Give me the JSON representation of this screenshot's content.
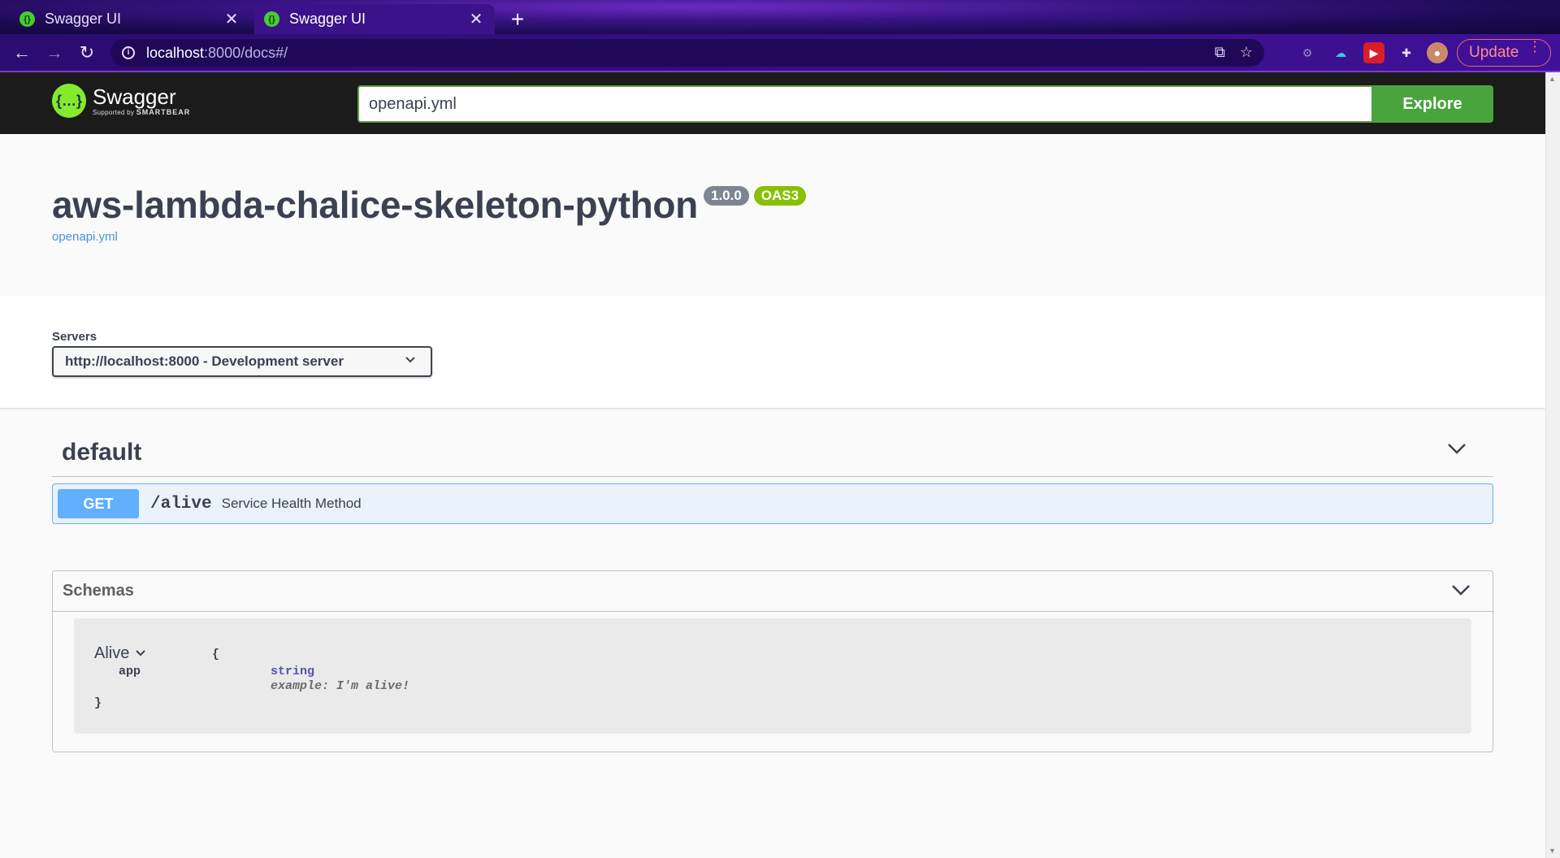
{
  "browser": {
    "tabs": [
      {
        "title": "Swagger UI",
        "active": false
      },
      {
        "title": "Swagger UI",
        "active": true
      }
    ],
    "new_tab_icon": "plus-icon",
    "url_host": "localhost",
    "url_path": ":8000/docs#/",
    "update_label": "Update"
  },
  "topbar": {
    "brand": "Swagger",
    "supported_by": "Supported by",
    "smartbear": "SMARTBEAR",
    "url_value": "openapi.yml",
    "explore_label": "Explore"
  },
  "info": {
    "title": "aws-lambda-chalice-skeleton-python",
    "version": "1.0.0",
    "oas": "OAS3",
    "spec_link": "openapi.yml"
  },
  "servers": {
    "label": "Servers",
    "selected": "http://localhost:8000 - Development server"
  },
  "operations": {
    "tag": "default",
    "items": [
      {
        "method": "GET",
        "path": "/alive",
        "summary": "Service Health Method"
      }
    ]
  },
  "schemas": {
    "header": "Schemas",
    "models": [
      {
        "name": "Alive",
        "open_brace": "{",
        "close_brace": "}",
        "properties": [
          {
            "name": "app",
            "type": "string",
            "example_label": "example:",
            "example_value": "I'm alive!"
          }
        ]
      }
    ]
  },
  "colors": {
    "get": "#61affe",
    "explore": "#49a43d",
    "oas_badge": "#89bf04",
    "version_badge": "#7d8492"
  }
}
